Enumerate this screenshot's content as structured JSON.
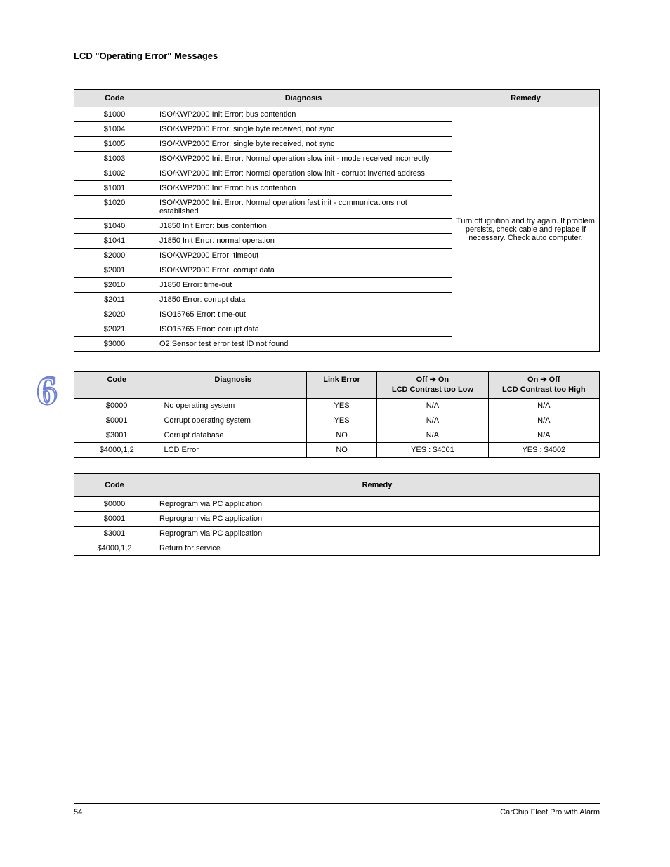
{
  "header": {
    "section_title": "LCD \"Operating Error\" Messages"
  },
  "table1": {
    "headers": [
      "Code",
      "Diagnosis",
      "Remedy"
    ],
    "remedy": "Turn off ignition and try again. If problem persists, check cable and replace if necessary. Check auto computer.",
    "rows": [
      {
        "code": "$1000",
        "diag": "ISO/KWP2000 Init Error: bus contention"
      },
      {
        "code": "$1004",
        "diag": "ISO/KWP2000 Error: single byte received, not sync"
      },
      {
        "code": "$1005",
        "diag": "ISO/KWP2000 Error: single byte received, not sync"
      },
      {
        "code": "$1003",
        "diag": "ISO/KWP2000 Init Error: Normal operation slow init - mode received incorrectly"
      },
      {
        "code": "$1002",
        "diag": "ISO/KWP2000 Init Error: Normal operation slow init - corrupt inverted address"
      },
      {
        "code": "$1001",
        "diag": "ISO/KWP2000 Init Error: bus contention"
      },
      {
        "code": "$1020",
        "diag": "ISO/KWP2000 Init Error: Normal operation fast init - communications not established"
      },
      {
        "code": "$1040",
        "diag": "J1850 Init Error: bus contention"
      },
      {
        "code": "$1041",
        "diag": "J1850 Init Error: normal operation"
      },
      {
        "code": "$2000",
        "diag": "ISO/KWP2000 Error: timeout"
      },
      {
        "code": "$2001",
        "diag": "ISO/KWP2000 Error: corrupt data"
      },
      {
        "code": "$2010",
        "diag": "J1850 Error: time-out"
      },
      {
        "code": "$2011",
        "diag": "J1850 Error: corrupt data"
      },
      {
        "code": "$2020",
        "diag": "ISO15765 Error: time-out"
      },
      {
        "code": "$2021",
        "diag": "ISO15765 Error: corrupt data"
      },
      {
        "code": "$3000",
        "diag": "O2 Sensor test error test ID not found"
      }
    ]
  },
  "table2": {
    "headers": {
      "code": "Code",
      "diag": "Diagnosis",
      "link": "Link Error",
      "lcd_off": "LCD Contrast too Low",
      "lcd_on": "LCD Contrast too High",
      "off_on": "Off ➔ On",
      "on_off": "On ➔ Off"
    },
    "rows": [
      {
        "code": "$0000",
        "diag": "No operating system",
        "link": "YES",
        "lcd_off": "N/A",
        "lcd_on": "N/A"
      },
      {
        "code": "$0001",
        "diag": "Corrupt operating system",
        "link": "YES",
        "lcd_off": "N/A",
        "lcd_on": "N/A"
      },
      {
        "code": "$3001",
        "diag": "Corrupt database",
        "link": "NO",
        "lcd_off": "N/A",
        "lcd_on": "N/A"
      },
      {
        "code": "$4000,1,2",
        "diag": "LCD Error",
        "link": "NO",
        "lcd_off": "YES : $4001",
        "lcd_on": "YES : $4002"
      }
    ]
  },
  "table3": {
    "headers": [
      "Code",
      "Remedy"
    ],
    "rows": [
      {
        "code": "$0000",
        "remedy": "Reprogram via PC application"
      },
      {
        "code": "$0001",
        "remedy": "Reprogram via PC application"
      },
      {
        "code": "$3001",
        "remedy": "Reprogram via PC application"
      },
      {
        "code": "$4000,1,2",
        "remedy": "Return for service"
      }
    ]
  },
  "footer": {
    "page": "54",
    "doc": "CarChip Fleet Pro with Alarm"
  }
}
